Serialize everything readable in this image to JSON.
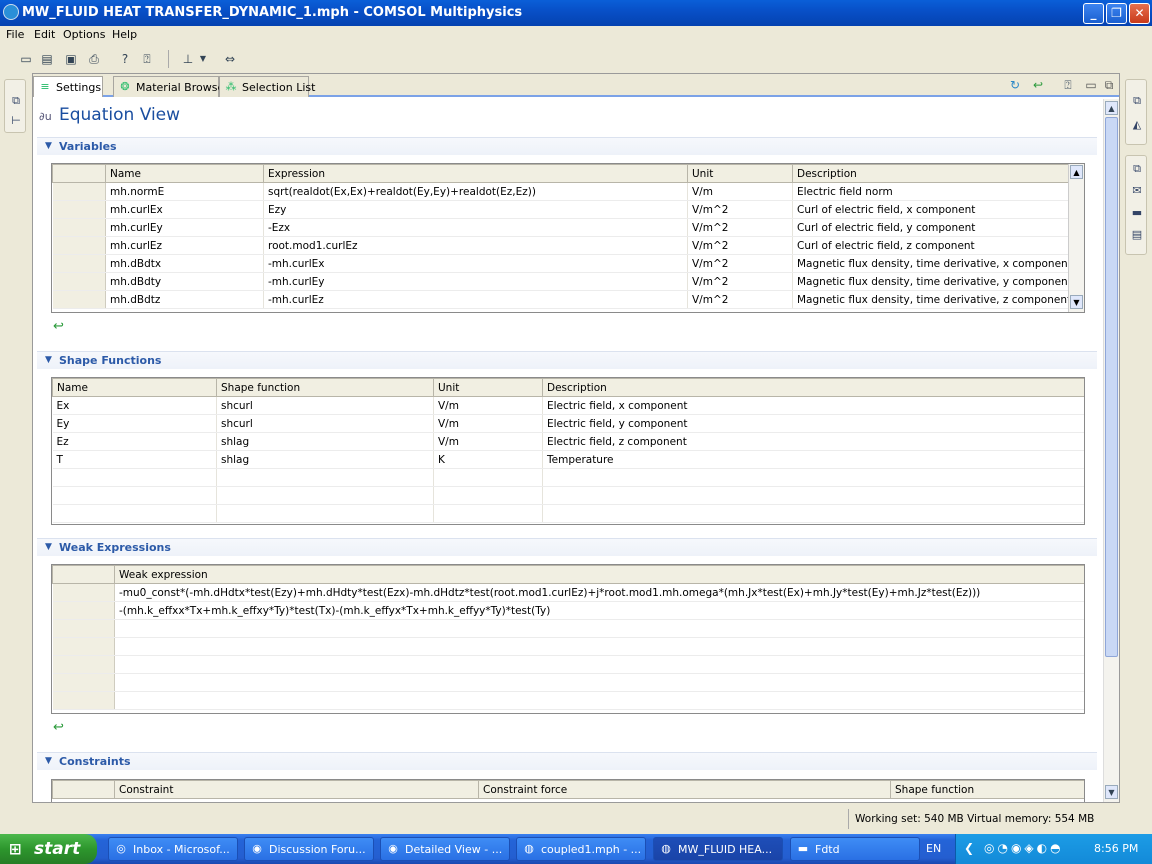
{
  "window": {
    "title": "MW_FLUID HEAT TRANSFER_DYNAMIC_1.mph - COMSOL Multiphysics",
    "min": "_",
    "max": "❐",
    "close": "✕"
  },
  "menu": [
    "File",
    "Edit",
    "Options",
    "Help"
  ],
  "tabs": [
    {
      "label": "Settings",
      "icon": "settings-icon"
    },
    {
      "label": "Material Browser",
      "icon": "material-browser-icon"
    },
    {
      "label": "Selection List",
      "icon": "selection-list-icon"
    }
  ],
  "page_title": "Equation View",
  "variables": {
    "section": "Variables",
    "columns": [
      "",
      "Name",
      "Expression",
      "Unit",
      "Description"
    ],
    "rows": [
      [
        "mh.normE",
        "sqrt(realdot(Ex,Ex)+realdot(Ey,Ey)+realdot(Ez,Ez))",
        "V/m",
        "Electric field norm"
      ],
      [
        "mh.curlEx",
        "Ezy",
        "V/m^2",
        "Curl of electric field, x component"
      ],
      [
        "mh.curlEy",
        "-Ezx",
        "V/m^2",
        "Curl of electric field, y component"
      ],
      [
        "mh.curlEz",
        "root.mod1.curlEz",
        "V/m^2",
        "Curl of electric field, z component"
      ],
      [
        "mh.dBdtx",
        "-mh.curlEx",
        "V/m^2",
        "Magnetic flux density, time derivative, x component"
      ],
      [
        "mh.dBdty",
        "-mh.curlEy",
        "V/m^2",
        "Magnetic flux density, time derivative, y component"
      ],
      [
        "mh.dBdtz",
        "-mh.curlEz",
        "V/m^2",
        "Magnetic flux density, time derivative, z component"
      ]
    ]
  },
  "shape_functions": {
    "section": "Shape Functions",
    "columns": [
      "Name",
      "Shape function",
      "Unit",
      "Description"
    ],
    "rows": [
      [
        "Ex",
        "shcurl",
        "V/m",
        "Electric field, x component"
      ],
      [
        "Ey",
        "shcurl",
        "V/m",
        "Electric field, y component"
      ],
      [
        "Ez",
        "shlag",
        "V/m",
        "Electric field, z component"
      ],
      [
        "T",
        "shlag",
        "K",
        "Temperature"
      ]
    ]
  },
  "weak_expressions": {
    "section": "Weak Expressions",
    "columns": [
      "",
      "Weak expression"
    ],
    "rows": [
      "-mu0_const*(-mh.dHdtx*test(Ezy)+mh.dHdty*test(Ezx)-mh.dHdtz*test(root.mod1.curlEz)+j*root.mod1.mh.omega*(mh.Jx*test(Ex)+mh.Jy*test(Ey)+mh.Jz*test(Ez)))",
      "-(mh.k_effxx*Tx+mh.k_effxy*Ty)*test(Tx)-(mh.k_effyx*Tx+mh.k_effyy*Ty)*test(Ty)"
    ]
  },
  "constraints": {
    "section": "Constraints",
    "columns": [
      "",
      "Constraint",
      "Constraint force",
      "Shape function"
    ]
  },
  "status": {
    "memory": "Working set: 540 MB  Virtual memory: 554 MB"
  },
  "taskbar": {
    "start": "start",
    "items": [
      {
        "label": "Inbox - Microsof...",
        "icon": "outlook-icon"
      },
      {
        "label": "Discussion Foru...",
        "icon": "chrome-icon"
      },
      {
        "label": "Detailed View - ...",
        "icon": "chrome-icon"
      },
      {
        "label": "coupled1.mph - ...",
        "icon": "comsol-icon"
      },
      {
        "label": "MW_FLUID HEA...",
        "icon": "comsol-icon"
      },
      {
        "label": "Fdtd",
        "icon": "folder-icon"
      }
    ],
    "lang": "EN",
    "clock": "8:56 PM"
  }
}
